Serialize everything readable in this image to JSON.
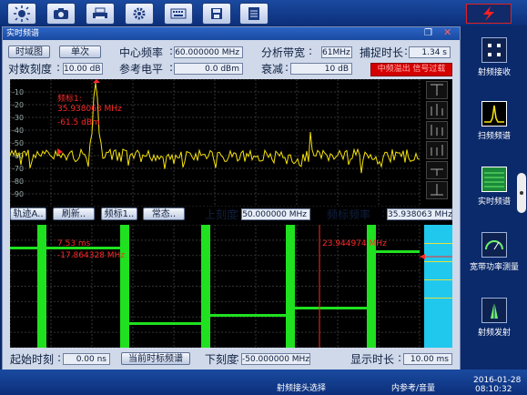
{
  "window": {
    "title": "实时频谱"
  },
  "toolbar": {
    "icons": [
      "brightness-icon",
      "camera-icon",
      "printer-icon",
      "gear-icon",
      "keyboard-icon",
      "save-icon",
      "document-icon"
    ]
  },
  "controls": {
    "mode_button": "时域图",
    "single_button": "单次",
    "center_freq_label": "中心频率",
    "center_freq_value": "60.000000 MHz",
    "span_label": "分析带宽",
    "span_value": "61MHz",
    "capture_label": "捕捉时长",
    "capture_value": "1.34 s",
    "log_scale_label": "对数刻度",
    "log_scale_value": "10.00 dB",
    "ref_level_label": "参考电平",
    "ref_level_value": "0.0 dBm",
    "atten_label": "衰减",
    "atten_value": "10 dB",
    "status_badge": "中频溢出 信号过载"
  },
  "spectrum": {
    "y_ticks": [
      "-10",
      "-20",
      "-30",
      "-40",
      "-50",
      "-60",
      "-70",
      "-80",
      "-90"
    ],
    "marker_label": "频标1:",
    "marker_freq": "35.938063 MHz",
    "marker_level": "-61.5 dBm"
  },
  "mid_controls": {
    "trace_button": "轨迹A..",
    "refresh_button": "刷新..",
    "marker_button": "频标1..",
    "normal_button": "常态..",
    "upper_scale_label": "上刻度",
    "upper_scale_value": "50.000000 MHz",
    "marker_freq_label": "频标频率",
    "marker_freq_value": "35.938063 MHz"
  },
  "waterfall": {
    "cursor1_time": "7.53 ms",
    "cursor1_freq": "-17.864328 MHz",
    "cursor2_freq": "23.944974 MHz"
  },
  "bottom_controls": {
    "start_time_label": "起始时刻",
    "start_time_value": "0.00 ns",
    "current_marker_button": "当前时标频谱",
    "lower_scale_label": "下刻度",
    "lower_scale_value": "-50.000000 MHz",
    "display_time_label": "显示时长",
    "display_time_value": "10.00 ms"
  },
  "sidebar": {
    "items": [
      {
        "label": "射频接收",
        "icon": "grid-icon"
      },
      {
        "label": "扫频频谱",
        "icon": "spectrum-peak-icon"
      },
      {
        "label": "实时频谱",
        "icon": "realtime-spectrum-icon"
      },
      {
        "label": "宽带功率测量",
        "icon": "gauge-icon"
      },
      {
        "label": "射频发射",
        "icon": "antenna-icon"
      }
    ]
  },
  "statusbar": {
    "left_text": "射频接头选择",
    "mid_text": "内参考/音量",
    "date": "2016-01-28",
    "time": "08:10:32"
  },
  "colors": {
    "trace": "#f5e20a",
    "waterfall": "#1fe11f",
    "marker": "#ff2a2a",
    "status_red": "#d40000"
  }
}
